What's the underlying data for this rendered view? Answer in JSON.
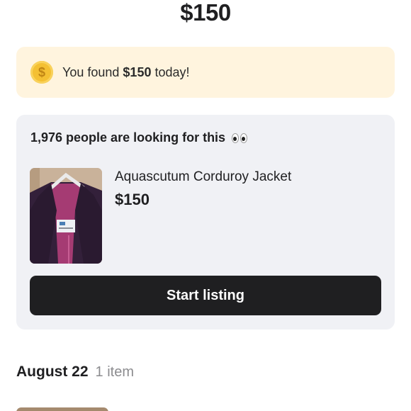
{
  "header": {
    "total": "$150"
  },
  "found_banner": {
    "icon": "coin-icon",
    "prefix": "You found ",
    "amount": "$150",
    "suffix": " today!",
    "color": "#fff4de"
  },
  "demand_card": {
    "heading": "1,976 people are looking for this",
    "emoji_icon": "eyes-icon",
    "item": {
      "title": "Aquascutum Corduroy Jacket",
      "price": "$150"
    },
    "cta_label": "Start listing",
    "background": "#f0f1f5"
  },
  "history": {
    "date": "August 22",
    "count": "1 item"
  }
}
